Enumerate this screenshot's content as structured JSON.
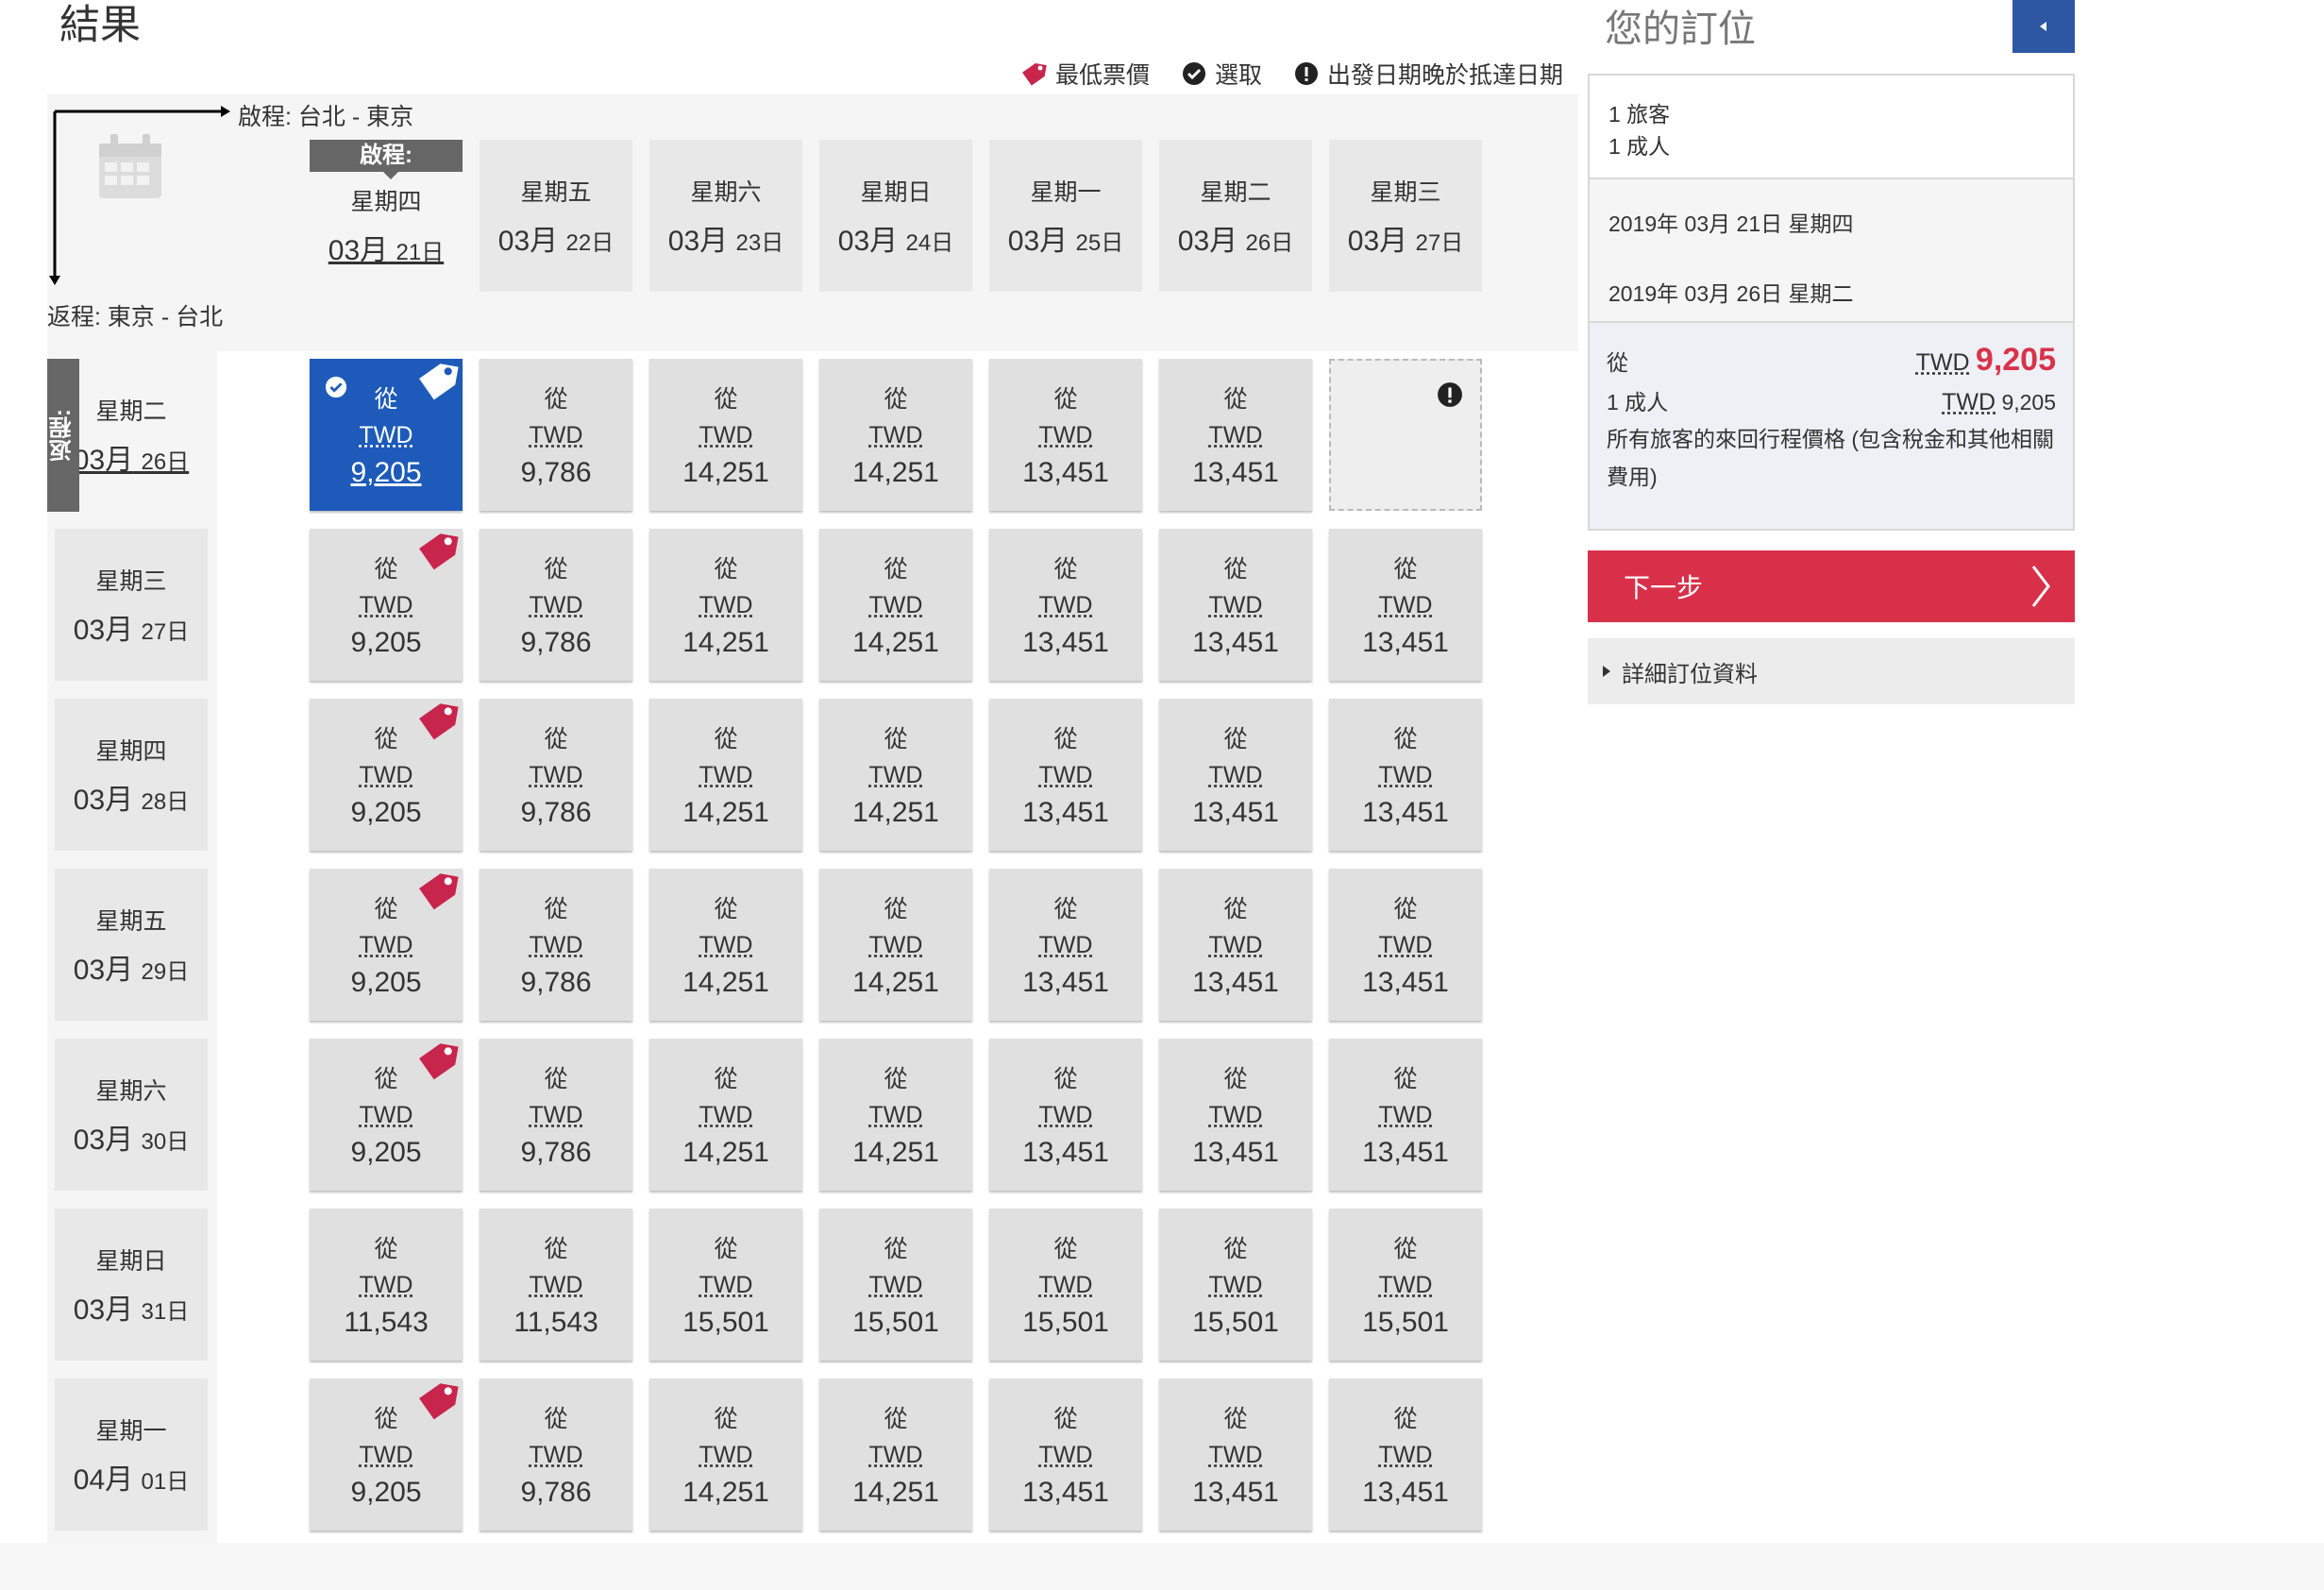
{
  "page_title": "結果",
  "legend": {
    "lowest_label": "最低票價",
    "selected_label": "選取",
    "warning_label": "出發日期晚於抵達日期"
  },
  "outbound_route": "啟程: 台北 - 東京",
  "return_route": "返程: 東京 - 台北",
  "outbound_tag": "啟程:",
  "return_tag": "返程:",
  "outbound_dates": [
    {
      "weekday": "星期四",
      "month": "03月",
      "day": "21日"
    },
    {
      "weekday": "星期五",
      "month": "03月",
      "day": "22日"
    },
    {
      "weekday": "星期六",
      "month": "03月",
      "day": "23日"
    },
    {
      "weekday": "星期日",
      "month": "03月",
      "day": "24日"
    },
    {
      "weekday": "星期一",
      "month": "03月",
      "day": "25日"
    },
    {
      "weekday": "星期二",
      "month": "03月",
      "day": "26日"
    },
    {
      "weekday": "星期三",
      "month": "03月",
      "day": "27日"
    }
  ],
  "return_dates": [
    {
      "weekday": "星期二",
      "month": "03月",
      "day": "26日"
    },
    {
      "weekday": "星期三",
      "month": "03月",
      "day": "27日"
    },
    {
      "weekday": "星期四",
      "month": "03月",
      "day": "28日"
    },
    {
      "weekday": "星期五",
      "month": "03月",
      "day": "29日"
    },
    {
      "weekday": "星期六",
      "month": "03月",
      "day": "30日"
    },
    {
      "weekday": "星期日",
      "month": "03月",
      "day": "31日"
    },
    {
      "weekday": "星期一",
      "month": "04月",
      "day": "01日"
    }
  ],
  "cell_from": "從",
  "currency": "TWD",
  "prices": [
    [
      "9,205",
      "9,786",
      "14,251",
      "14,251",
      "13,451",
      "13,451",
      null
    ],
    [
      "9,205",
      "9,786",
      "14,251",
      "14,251",
      "13,451",
      "13,451",
      "13,451"
    ],
    [
      "9,205",
      "9,786",
      "14,251",
      "14,251",
      "13,451",
      "13,451",
      "13,451"
    ],
    [
      "9,205",
      "9,786",
      "14,251",
      "14,251",
      "13,451",
      "13,451",
      "13,451"
    ],
    [
      "9,205",
      "9,786",
      "14,251",
      "14,251",
      "13,451",
      "13,451",
      "13,451"
    ],
    [
      "11,543",
      "11,543",
      "15,501",
      "15,501",
      "15,501",
      "15,501",
      "15,501"
    ],
    [
      "9,205",
      "9,786",
      "14,251",
      "14,251",
      "13,451",
      "13,451",
      "13,451"
    ]
  ],
  "lowest_fare_rows": [
    0,
    1,
    2,
    3,
    4,
    6
  ],
  "booking": {
    "title": "您的訂位",
    "travellers": "1 旅客",
    "adults": "1 成人",
    "depart_date": "2019年 03月 21日 星期四",
    "return_date": "2019年 03月 26日 星期二",
    "from_label": "從",
    "total_currency": "TWD",
    "total_price": "9,205",
    "adult_label": "1 成人",
    "adult_currency": "TWD",
    "adult_price": "9,205",
    "note": "所有旅客的來回行程價格 (包含稅金和其他相關費用)",
    "next_label": "下一步",
    "details_label": "詳細訂位資料"
  },
  "colors": {
    "selected_cell": "#1d5ab9",
    "lowest_tag": "#c8254c",
    "next_button": "#d9304a",
    "total_price": "#d8334a",
    "collapse_button": "#2d56a3"
  }
}
